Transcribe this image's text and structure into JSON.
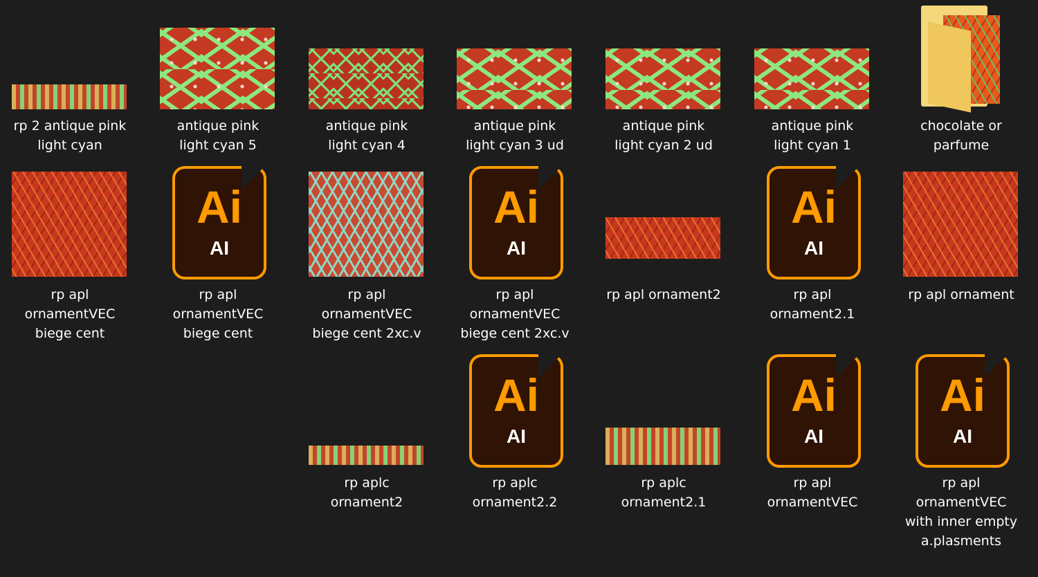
{
  "files": [
    {
      "name": "rp 2 antique pink\nlight cyan",
      "type": "image"
    },
    {
      "name": "antique pink\nlight cyan 5",
      "type": "image"
    },
    {
      "name": "antique pink\nlight cyan 4",
      "type": "image"
    },
    {
      "name": "antique pink\nlight cyan 3 ud",
      "type": "image"
    },
    {
      "name": "antique pink\nlight cyan 2 ud",
      "type": "image"
    },
    {
      "name": "antique pink\nlight cyan 1",
      "type": "image"
    },
    {
      "name": "chocolate or\nparfume",
      "type": "folder"
    },
    {
      "name": "rp apl\nornamentVEC\nbiege cent",
      "type": "image"
    },
    {
      "name": "rp apl\nornamentVEC\nbiege cent",
      "type": "ai"
    },
    {
      "name": "rp apl\nornamentVEC\nbiege cent 2xc.v",
      "type": "image"
    },
    {
      "name": "rp apl\nornamentVEC\nbiege cent 2xc.v",
      "type": "ai"
    },
    {
      "name": "rp apl ornament2",
      "type": "image"
    },
    {
      "name": "rp apl\nornament2.1",
      "type": "ai"
    },
    {
      "name": "rp apl ornament",
      "type": "image"
    },
    {
      "name": "rp aplc\nornament2",
      "type": "image"
    },
    {
      "name": "rp aplc\nornament2.2",
      "type": "ai"
    },
    {
      "name": "rp aplc\nornament2.1",
      "type": "image"
    },
    {
      "name": "rp apl\nornamentVEC",
      "type": "ai"
    },
    {
      "name": "rp apl\nornamentVEC\nwith inner empty\na.plasments",
      "type": "ai"
    }
  ],
  "ai_icon": {
    "big_text": "Ai",
    "small_text": "AI",
    "accent": "#ff9a00",
    "bg": "#2f1304"
  },
  "colors": {
    "background": "#1d1d1d",
    "text": "#ffffff"
  }
}
